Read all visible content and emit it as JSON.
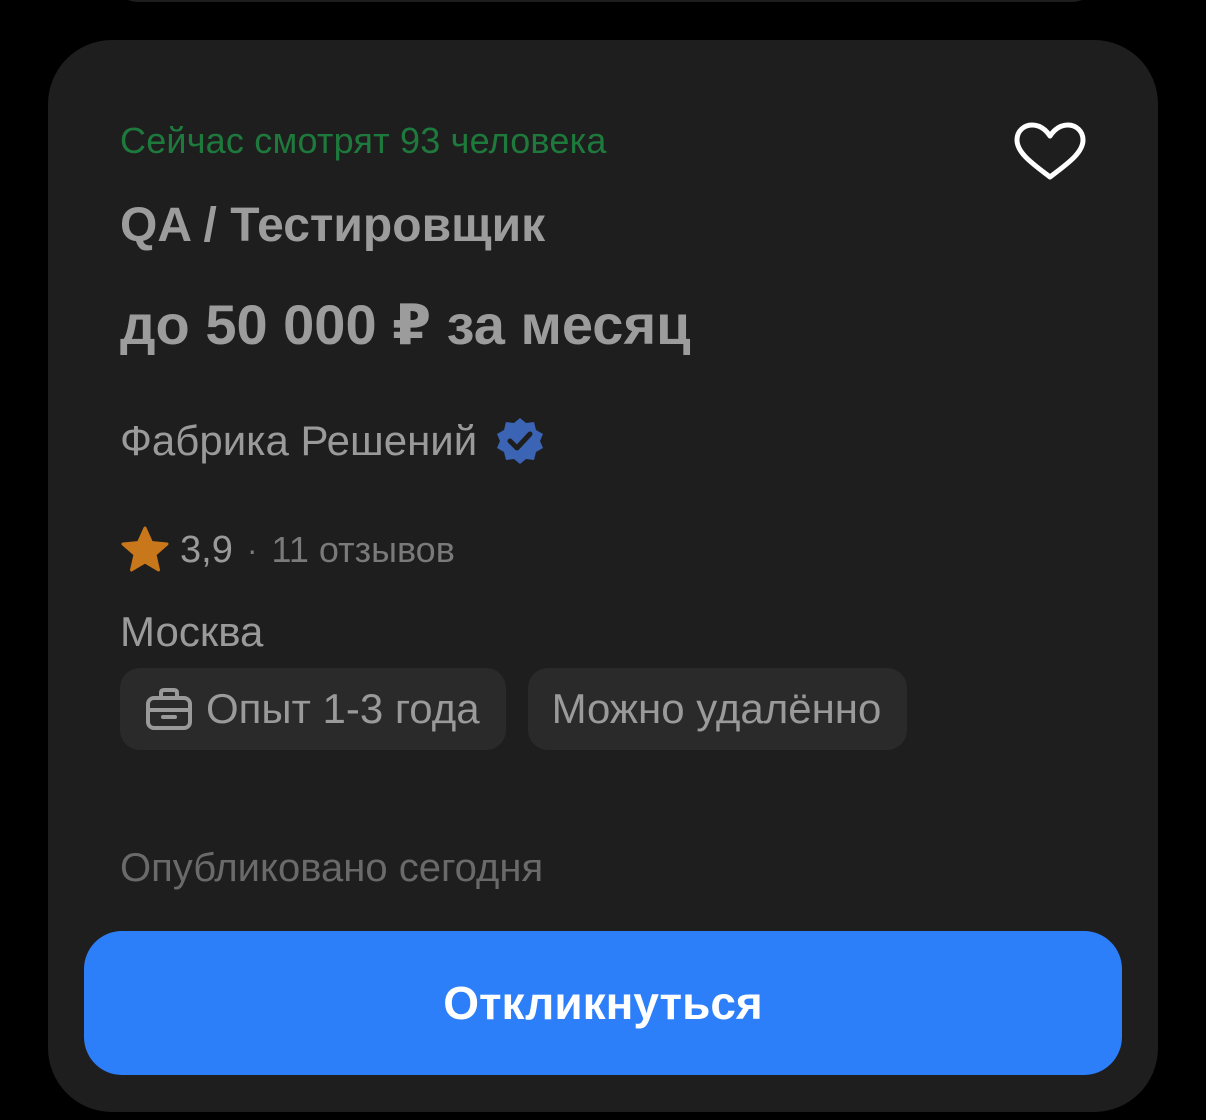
{
  "vacancy": {
    "viewers_text": "Сейчас смотрят 93 человека",
    "title": "QA / Тестировщик",
    "salary": "до 50 000 ₽ за месяц",
    "company": {
      "name": "Фабрика Решений",
      "verified_icon": "verified-badge-icon"
    },
    "rating": {
      "value": "3,9",
      "separator": "·",
      "reviews": "11 отзывов",
      "icon": "star-icon"
    },
    "city": "Москва",
    "chips": [
      {
        "label": "Опыт 1-3 года",
        "icon": "briefcase-icon"
      },
      {
        "label": "Можно удалённо"
      }
    ],
    "published": "Опубликовано сегодня",
    "apply_label": "Откликнуться",
    "favorite_icon": "heart-outline-icon"
  },
  "colors": {
    "accent": "#2d7ff9",
    "viewers": "#1e7a3c",
    "star": "#c8771a",
    "verified": "#3c64b4",
    "card_bg": "#1e1e1e",
    "page_bg": "#000000"
  }
}
